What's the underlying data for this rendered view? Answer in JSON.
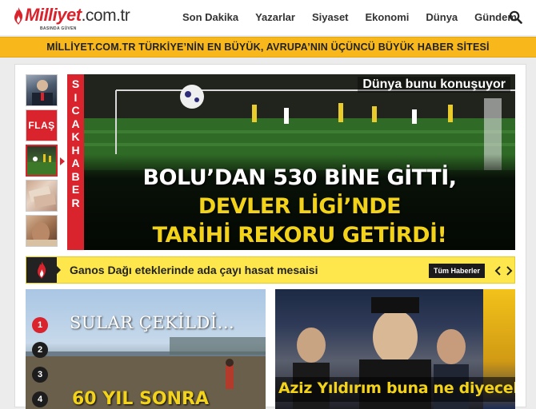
{
  "header": {
    "logo_brand": "Milliyet",
    "logo_tld": ".com.tr",
    "logo_slogan": "BASINDA GÜVEN",
    "nav": [
      "Son Dakika",
      "Yazarlar",
      "Siyaset",
      "Ekonomi",
      "Dünya",
      "Gündem"
    ]
  },
  "banner": {
    "text": "MİLLİYET.COM.TR TÜRKİYE’NİN EN BÜYÜK, AVRUPA’NIN ÜÇÜNCÜ BÜYÜK HABER SİTESİ"
  },
  "headline": {
    "thumb_flas": "FLAŞ",
    "side_label": [
      "S",
      "I",
      "C",
      "A",
      "K",
      " ",
      "H",
      "A",
      "B",
      "E",
      "R"
    ],
    "tag": "Dünya bunu konuşuyor",
    "lines": [
      "BOLU’DAN 530 BİNE GİTTİ,",
      "DEVLER LİGİ’NDE",
      "TARİHİ REKORU GETİRDİ!"
    ]
  },
  "ticker": {
    "text": "Ganos Dağı eteklerinde ada çayı hasat mesaisi",
    "button": "Tüm Haberler"
  },
  "card_left": {
    "title": "SULAR ÇEKİLDİ...",
    "subtitle": "60 YIL SONRA",
    "numbers": [
      "1",
      "2",
      "3",
      "4"
    ]
  },
  "card_right": {
    "title": "Aziz Yıldırım buna ne diyecek?"
  },
  "colors": {
    "brand_red": "#d9232d",
    "banner_yellow": "#f8b81c",
    "ticker_yellow": "#fde74c",
    "headline_yellow": "#f3d21a"
  }
}
